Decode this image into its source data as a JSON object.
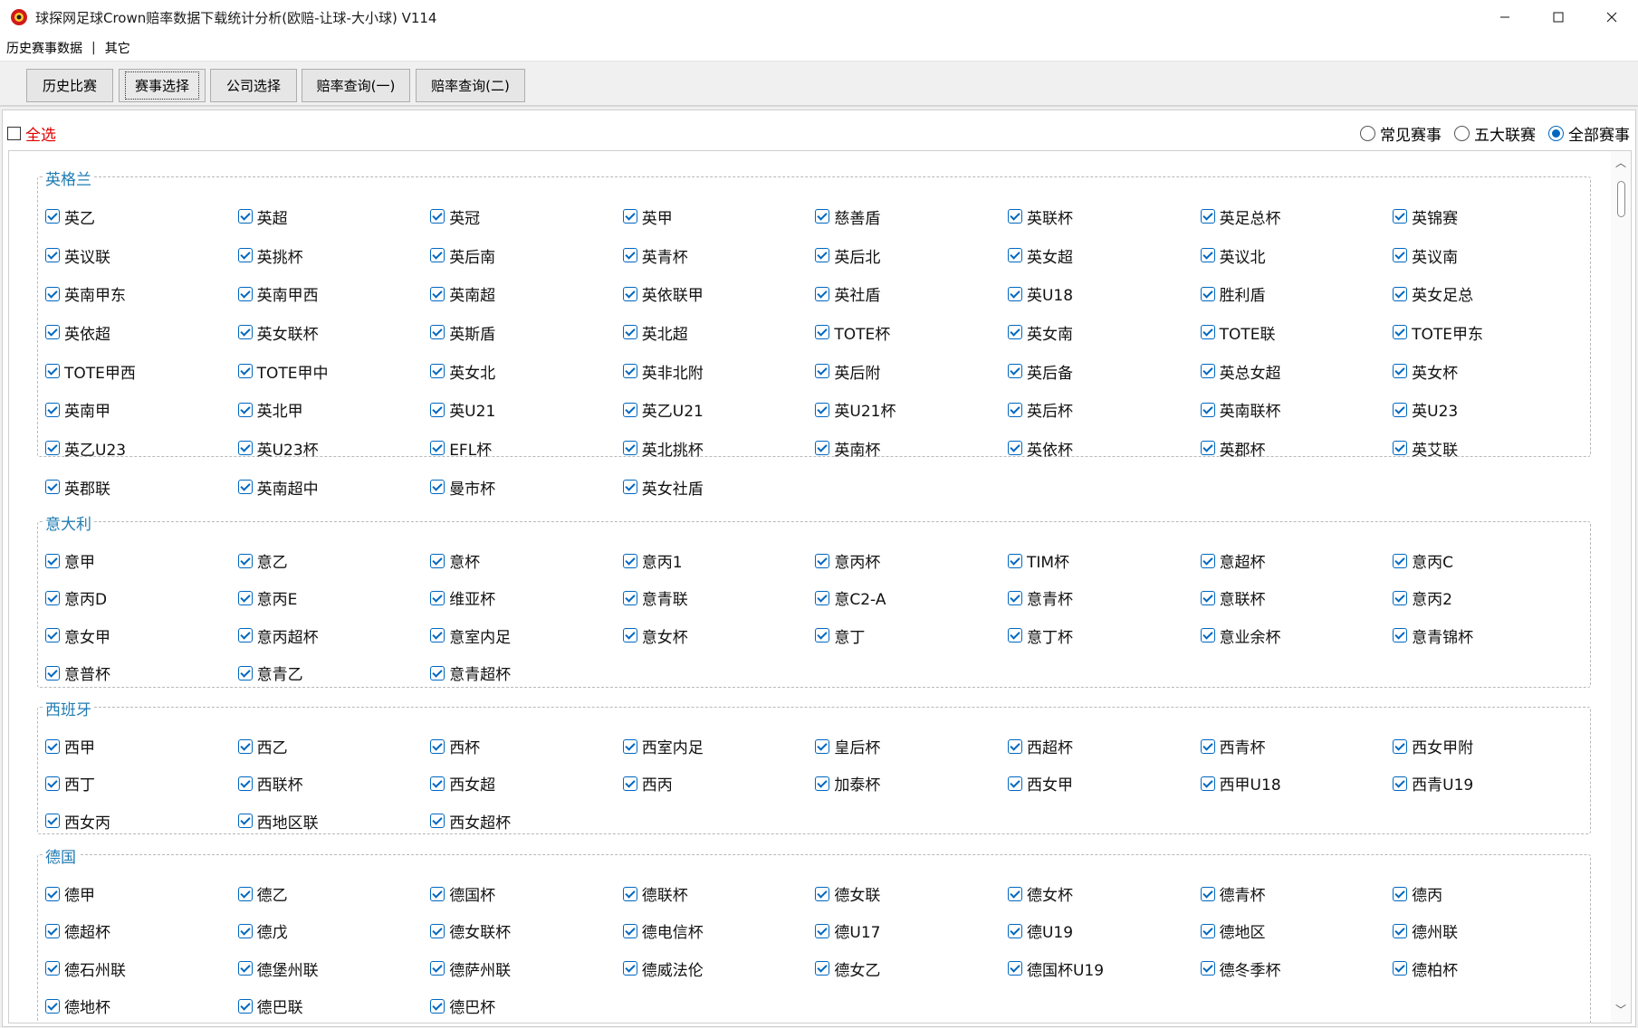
{
  "window": {
    "title": "球探网足球Crown赔率数据下载统计分析(欧赔-让球-大小球) V114",
    "controls": [
      "minimize",
      "maximize",
      "close"
    ]
  },
  "menu": {
    "items": [
      "历史赛事数据",
      "其它"
    ],
    "separator": "|"
  },
  "tabs": [
    {
      "label": "历史比赛",
      "active": false
    },
    {
      "label": "赛事选择",
      "active": true
    },
    {
      "label": "公司选择",
      "active": false
    },
    {
      "label": "赔率查询(一)",
      "active": false
    },
    {
      "label": "赔率查询(二)",
      "active": false
    }
  ],
  "select_all": {
    "label": "全选",
    "checked": false
  },
  "filters": [
    {
      "label": "常见赛事",
      "selected": false
    },
    {
      "label": "五大联赛",
      "selected": false
    },
    {
      "label": "全部赛事",
      "selected": true
    }
  ],
  "groups": [
    {
      "title": "英格兰",
      "items": [
        "英乙",
        "英超",
        "英冠",
        "英甲",
        "慈善盾",
        "英联杯",
        "英足总杯",
        "英锦赛",
        "英议联",
        "英挑杯",
        "英后南",
        "英青杯",
        "英后北",
        "英女超",
        "英议北",
        "英议南",
        "英南甲东",
        "英南甲西",
        "英南超",
        "英依联甲",
        "英社盾",
        "英U18",
        "胜利盾",
        "英女足总",
        "英依超",
        "英女联杯",
        "英斯盾",
        "英北超",
        "TOTE杯",
        "英女南",
        "TOTE联",
        "TOTE甲东",
        "TOTE甲西",
        "TOTE甲中",
        "英女北",
        "英非北附",
        "英后附",
        "英后备",
        "英总女超",
        "英女杯",
        "英南甲",
        "英北甲",
        "英U21",
        "英乙U21",
        "英U21杯",
        "英后杯",
        "英南联杯",
        "英U23",
        "英乙U23",
        "英U23杯",
        "EFL杯",
        "英北挑杯",
        "英南杯",
        "英依杯",
        "英郡杯",
        "英艾联",
        "英郡联",
        "英南超中",
        "曼市杯",
        "英女社盾"
      ]
    },
    {
      "title": "意大利",
      "items": [
        "意甲",
        "意乙",
        "意杯",
        "意丙1",
        "意丙杯",
        "TIM杯",
        "意超杯",
        "意丙C",
        "意丙D",
        "意丙E",
        "维亚杯",
        "意青联",
        "意C2-A",
        "意青杯",
        "意联杯",
        "意丙2",
        "意女甲",
        "意丙超杯",
        "意室内足",
        "意女杯",
        "意丁",
        "意丁杯",
        "意业余杯",
        "意青锦杯",
        "意普杯",
        "意青乙",
        "意青超杯"
      ]
    },
    {
      "title": "西班牙",
      "items": [
        "西甲",
        "西乙",
        "西杯",
        "西室内足",
        "皇后杯",
        "西超杯",
        "西青杯",
        "西女甲附",
        "西丁",
        "西联杯",
        "西女超",
        "西丙",
        "加泰杯",
        "西女甲",
        "西甲U18",
        "西青U19",
        "西女丙",
        "西地区联",
        "西女超杯"
      ]
    },
    {
      "title": "德国",
      "items": [
        "德甲",
        "德乙",
        "德国杯",
        "德联杯",
        "德女联",
        "德女杯",
        "德青杯",
        "德丙",
        "德超杯",
        "德戊",
        "德女联杯",
        "德电信杯",
        "德U17",
        "德U19",
        "德地区",
        "德州联",
        "德石州联",
        "德堡州联",
        "德萨州联",
        "德威法伦",
        "德女乙",
        "德国杯U19",
        "德冬季杯",
        "德柏杯",
        "德地杯",
        "德巴联",
        "德巴杯"
      ]
    }
  ]
}
